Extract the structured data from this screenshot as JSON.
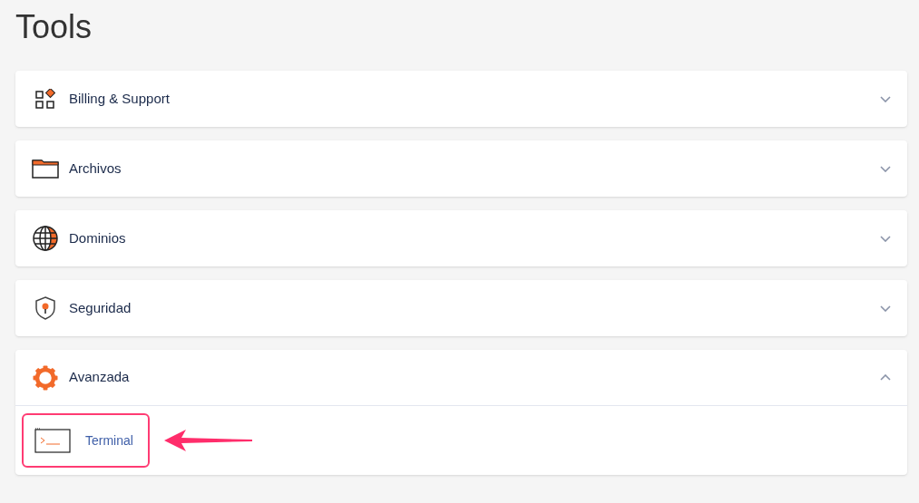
{
  "title": "Tools",
  "sections": [
    {
      "label": "Billing & Support",
      "kind": "apps",
      "expanded": false
    },
    {
      "label": "Archivos",
      "kind": "folder",
      "expanded": false
    },
    {
      "label": "Dominios",
      "kind": "globe",
      "expanded": false
    },
    {
      "label": "Seguridad",
      "kind": "shield",
      "expanded": false
    },
    {
      "label": "Avanzada",
      "kind": "gear",
      "expanded": true,
      "items": [
        {
          "label": "Terminal",
          "highlighted": true
        }
      ]
    }
  ]
}
